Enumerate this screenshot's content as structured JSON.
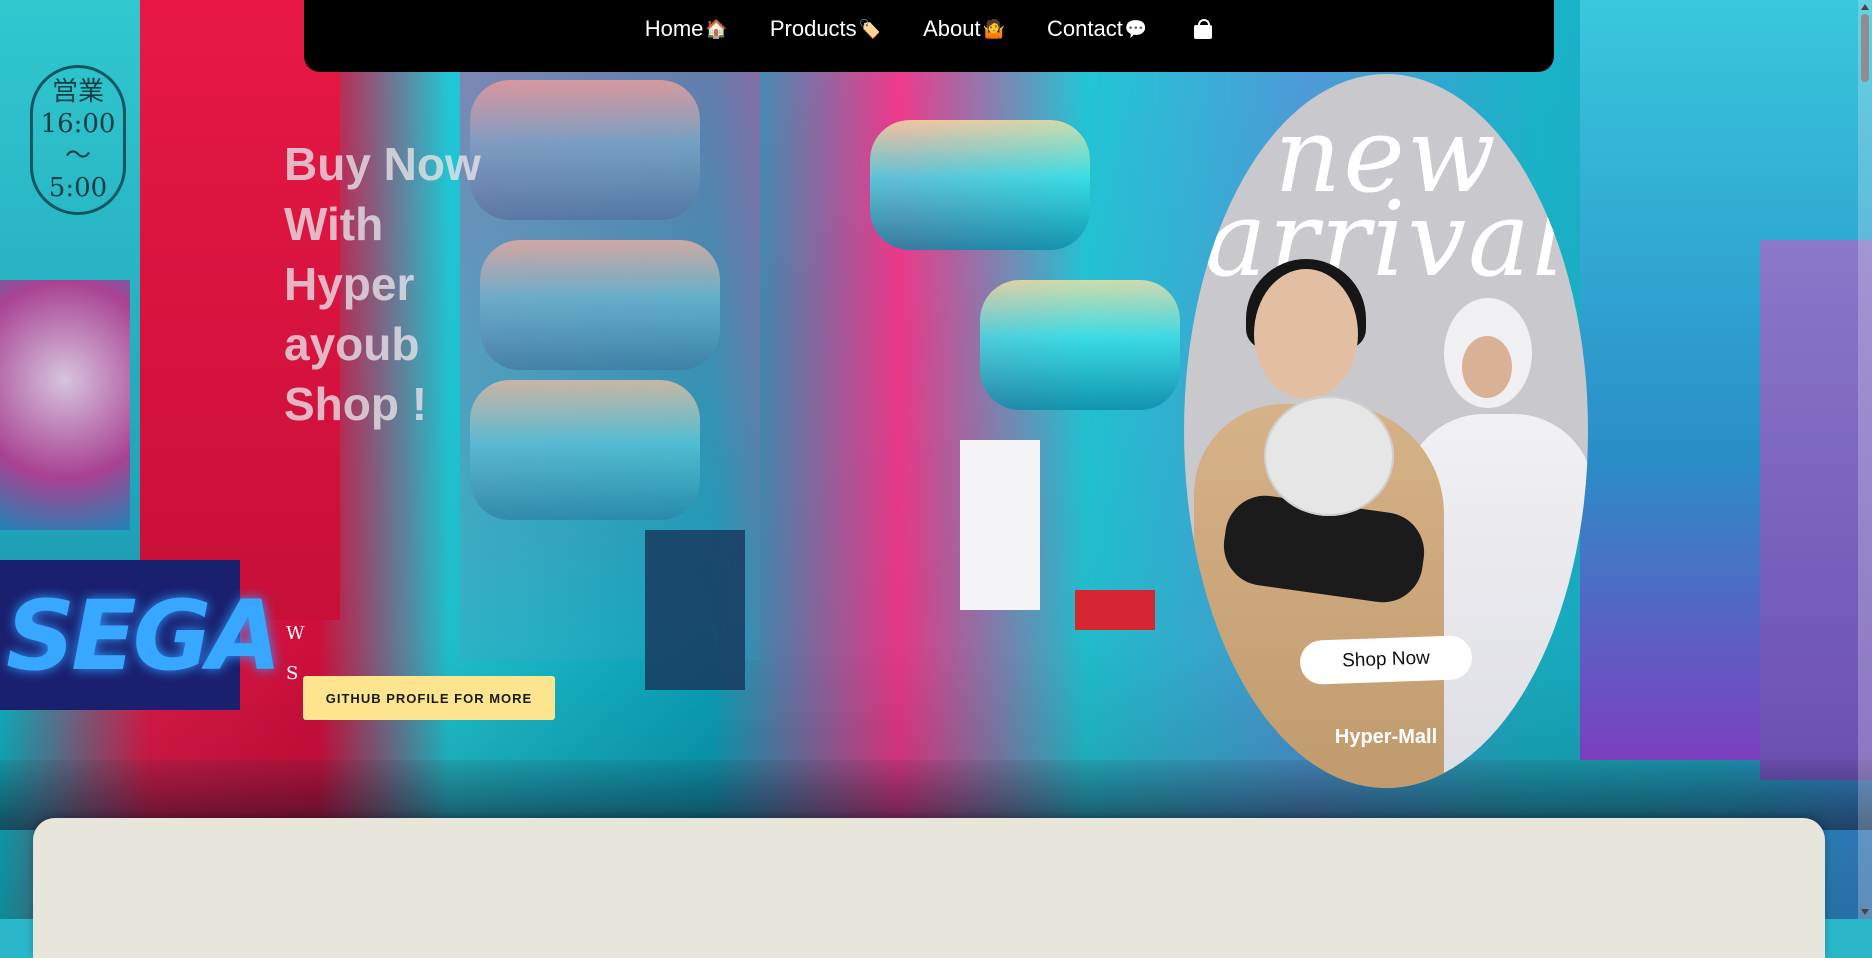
{
  "nav": {
    "items": [
      {
        "label": "Home",
        "emoji": "🏠"
      },
      {
        "label": "Products",
        "emoji": "🏷️"
      },
      {
        "label": "About",
        "emoji": "🤷"
      },
      {
        "label": "Contact",
        "emoji": "💬"
      }
    ],
    "cart_icon": "shopping-bag-icon"
  },
  "hero": {
    "title_lines": [
      "Buy Now",
      "With",
      "Hyper",
      "ayoub",
      "Shop !"
    ],
    "side_letters": [
      "W",
      "S"
    ],
    "github_button": "GITHUB PROFILE FOR MORE"
  },
  "promo": {
    "headline_1": "new",
    "headline_2": "arrival",
    "shop_button": "Shop Now",
    "brand": "Hyper-Mall"
  },
  "colors": {
    "nav_bg": "#000000",
    "github_button_bg": "#fde58f",
    "promo_bg": "#c9c8cc",
    "panel_bg": "#e8e6da"
  }
}
